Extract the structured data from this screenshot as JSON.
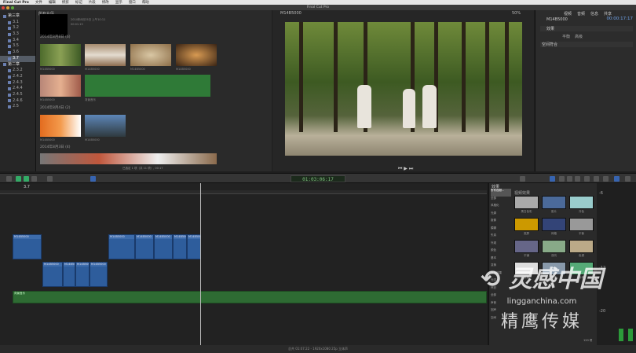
{
  "menubar": {
    "app": "Final Cut Pro",
    "items": [
      "文件",
      "编辑",
      "修剪",
      "标记",
      "片段",
      "修改",
      "显示",
      "窗口",
      "帮助"
    ]
  },
  "window": {
    "title": "Final Cut Pro"
  },
  "library": {
    "items": [
      {
        "label": "第三章",
        "type": "event-group"
      },
      {
        "label": "3.1"
      },
      {
        "label": "3.2"
      },
      {
        "label": "3.3"
      },
      {
        "label": "3.4"
      },
      {
        "label": "3.5"
      },
      {
        "label": "3.6"
      },
      {
        "label": "3.7",
        "selected": true
      },
      {
        "label": "第二章",
        "type": "event-group"
      },
      {
        "label": "2.3.2"
      },
      {
        "label": "2.4.2"
      },
      {
        "label": "2.4.3"
      },
      {
        "label": "2.4.4"
      },
      {
        "label": "2.4.5"
      },
      {
        "label": "2.4.6"
      },
      {
        "label": "2.5"
      }
    ]
  },
  "browser": {
    "header": "所有片段",
    "top_clip_info": "2014年8月25日 上午10:11",
    "top_clip_duration": "00:01:15",
    "groups": [
      {
        "date": "2014年8月8日",
        "count": "(6)",
        "clips": [
          "M14B5000",
          "M14B5000",
          "M14B5000",
          "M14B5000",
          "M14B5000",
          "背景音乐"
        ]
      },
      {
        "date": "2014年8月4日",
        "count": "(2)",
        "clips": [
          "M14B5000",
          "M14B5000"
        ]
      },
      {
        "date": "2014年8月3日",
        "count": "(4)",
        "clips": []
      }
    ],
    "footer": "已选定 1 项（共 11 项）, 00:17"
  },
  "viewer": {
    "clip_name": "M14B5000",
    "zoom": "50%"
  },
  "inspector": {
    "tabs": [
      "视频",
      "音频",
      "信息",
      "共享"
    ],
    "clip_name": "M14B5000",
    "duration": "00:00:17:17",
    "section1": "效果",
    "sub1": "平衡",
    "sub2": "高级",
    "section2": "空间符合"
  },
  "toolbar": {
    "timecode": "01:03:06:17"
  },
  "timeline": {
    "project": "3.7",
    "clips_top": [
      "M14B5000",
      "M14B5000",
      "M14B5000",
      "M14B5000",
      "M14B5000",
      "M14B5000"
    ],
    "clips_bottom": [
      "M14B5000",
      "M14B5000",
      "M14B5000",
      "M14B5000"
    ],
    "audio": "背景音乐"
  },
  "effects": {
    "header": "效果",
    "categories": [
      "所有视频...",
      "全部",
      "风格化",
      "光源",
      "抠像",
      "模糊",
      "失真",
      "外观",
      "颜色",
      "基本",
      "变换",
      "文本效果",
      "光学",
      "怀旧",
      "全部",
      "声音",
      "回声",
      "空间"
    ],
    "section": "视频效果",
    "items": [
      "黑白色彩",
      "胶片",
      "冷色",
      "宽屏",
      "网格",
      "平衡",
      "平铺",
      "双向",
      "色调",
      "夜视",
      "晕影",
      "对称"
    ],
    "count": "120 项"
  },
  "meters": {
    "labels": [
      "-6",
      "-12",
      "-20"
    ]
  },
  "statusbar": "总共 01:07:22 - 1920x1080 25p 立体声",
  "watermark": {
    "brand": "灵感中国",
    "url": "lingganchina.com",
    "sub": "精鹰传媒"
  }
}
